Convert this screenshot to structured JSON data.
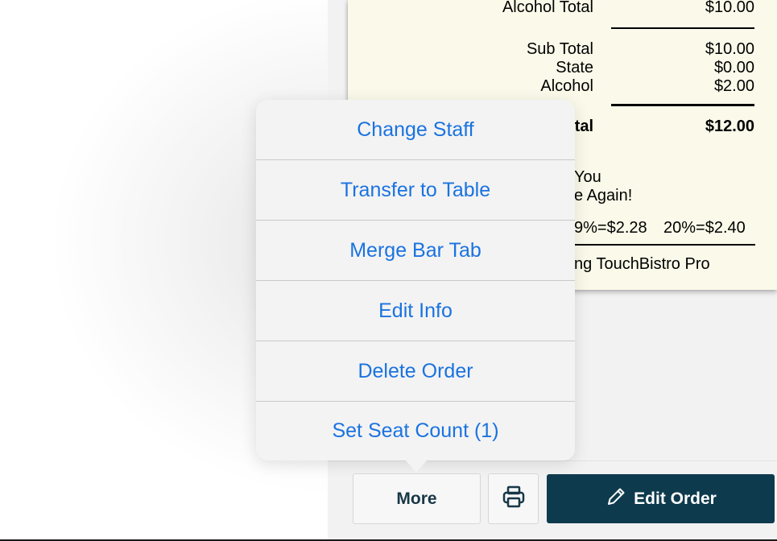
{
  "receipt": {
    "alcohol_total_label": "Alcohol Total",
    "alcohol_total_value": "$10.00",
    "sub_total_label": "Sub Total",
    "sub_total_value": "$10.00",
    "state_label": "State",
    "state_value": "$0.00",
    "alcohol_label": "Alcohol",
    "alcohol_value": "$2.00",
    "total_label_partial": "tal",
    "total_value": "$12.00",
    "thanks_line1_partial": "You",
    "thanks_line2_partial": "e Again!",
    "tip_partial": "9%=$2.28",
    "tip_20": "20%=$2.40",
    "footer_partial": "ng TouchBistro Pro"
  },
  "menu": {
    "items": [
      {
        "label": "Change Staff"
      },
      {
        "label": "Transfer to Table"
      },
      {
        "label": "Merge Bar Tab"
      },
      {
        "label": "Edit Info"
      },
      {
        "label": "Delete Order"
      },
      {
        "label": "Set Seat Count (1)"
      }
    ]
  },
  "toolbar": {
    "more_label": "More",
    "edit_order_label": "Edit Order",
    "print_icon": "printer-icon",
    "edit_icon": "pencil-icon"
  },
  "colors": {
    "accent": "#1a73e0",
    "primary_button": "#0e3a4d",
    "receipt_paper": "#fbfaea"
  }
}
